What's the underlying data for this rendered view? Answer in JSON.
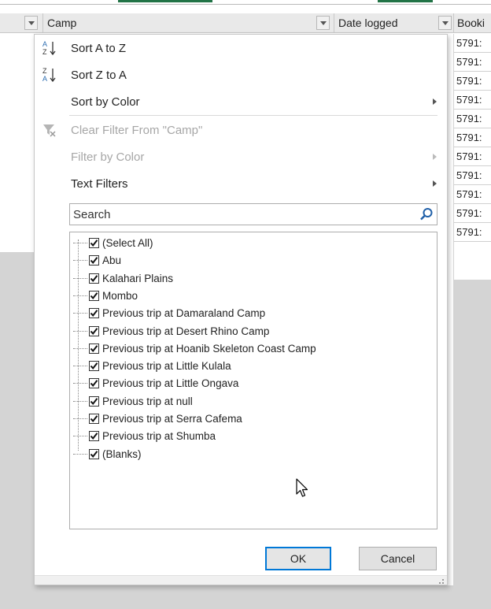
{
  "header": {
    "camp_label": "Camp",
    "date_logged_label": "Date logged",
    "booking_label": "Booki"
  },
  "booking_cells": [
    "5791:",
    "5791:",
    "5791:",
    "5791:",
    "5791:",
    "5791:",
    "5791:",
    "5791:",
    "5791:",
    "5791:",
    "5791:"
  ],
  "menu": {
    "sort_az": "Sort A to Z",
    "sort_za": "Sort Z to A",
    "sort_by_color": "Sort by Color",
    "clear_filter": "Clear Filter From \"Camp\"",
    "filter_by_color": "Filter by Color",
    "text_filters": "Text Filters"
  },
  "search": {
    "placeholder": "Search"
  },
  "filter_items": [
    {
      "label": "(Select All)",
      "checked": true
    },
    {
      "label": "Abu",
      "checked": true
    },
    {
      "label": "Kalahari Plains",
      "checked": true
    },
    {
      "label": "Mombo",
      "checked": true
    },
    {
      "label": "Previous trip at Damaraland Camp",
      "checked": true
    },
    {
      "label": "Previous trip at Desert Rhino Camp",
      "checked": true
    },
    {
      "label": "Previous trip at Hoanib Skeleton Coast Camp",
      "checked": true
    },
    {
      "label": "Previous trip at Little Kulala",
      "checked": true
    },
    {
      "label": "Previous trip at Little Ongava",
      "checked": true
    },
    {
      "label": "Previous trip at null",
      "checked": true
    },
    {
      "label": "Previous trip at Serra Cafema",
      "checked": true
    },
    {
      "label": "Previous trip at Shumba",
      "checked": true
    },
    {
      "label": "(Blanks)",
      "checked": true
    }
  ],
  "buttons": {
    "ok": "OK",
    "cancel": "Cancel"
  },
  "colors": {
    "accent": "#0078d7",
    "excel_green": "#217346",
    "disabled_text": "#a6a6a6"
  }
}
